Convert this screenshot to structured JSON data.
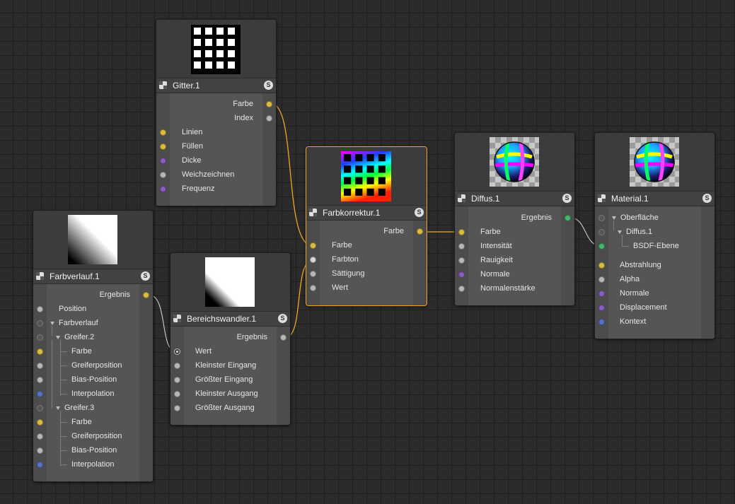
{
  "nodes": {
    "gitter": {
      "title": "Gitter.1",
      "outputs": [
        {
          "label": "Farbe"
        },
        {
          "label": "Index"
        }
      ],
      "inputs": [
        {
          "label": "Linien"
        },
        {
          "label": "Füllen"
        },
        {
          "label": "Dicke"
        },
        {
          "label": "Weichzeichnen"
        },
        {
          "label": "Frequenz"
        }
      ]
    },
    "farbverlauf": {
      "title": "Farbverlauf.1",
      "output": "Ergebnis",
      "rows": [
        {
          "label": "Position"
        },
        {
          "label": "Farbverlauf"
        },
        {
          "label": "Greifer.2"
        },
        {
          "label": "Farbe"
        },
        {
          "label": "Greiferposition"
        },
        {
          "label": "Bias-Position"
        },
        {
          "label": "Interpolation"
        },
        {
          "label": "Greifer.3"
        },
        {
          "label": "Farbe"
        },
        {
          "label": "Greiferposition"
        },
        {
          "label": "Bias-Position"
        },
        {
          "label": "Interpolation"
        }
      ]
    },
    "bereichswandler": {
      "title": "Bereichswandler.1",
      "output": "Ergebnis",
      "inputs": [
        {
          "label": "Wert"
        },
        {
          "label": "Kleinster Eingang"
        },
        {
          "label": "Größter Eingang"
        },
        {
          "label": "Kleinster Ausgang"
        },
        {
          "label": "Größter Ausgang"
        }
      ]
    },
    "farbkorrektur": {
      "title": "Farbkorrektur.1",
      "output": "Farbe",
      "inputs": [
        {
          "label": "Farbe"
        },
        {
          "label": "Farbton"
        },
        {
          "label": "Sättigung"
        },
        {
          "label": "Wert"
        }
      ]
    },
    "diffus": {
      "title": "Diffus.1",
      "output": "Ergebnis",
      "inputs": [
        {
          "label": "Farbe"
        },
        {
          "label": "Intensität"
        },
        {
          "label": "Rauigkeit"
        },
        {
          "label": "Normale"
        },
        {
          "label": "Normalenstärke"
        }
      ]
    },
    "material": {
      "title": "Material.1",
      "tree": [
        {
          "label": "Oberfläche"
        },
        {
          "label": "Diffus.1"
        },
        {
          "label": "BSDF-Ebene"
        }
      ],
      "inputs": [
        {
          "label": "Abstrahlung"
        },
        {
          "label": "Alpha"
        },
        {
          "label": "Normale"
        },
        {
          "label": "Displacement"
        },
        {
          "label": "Kontext"
        }
      ]
    }
  },
  "solo_label": "S",
  "colors": {
    "wire": "#f0a623",
    "wire_grey": "#cfcfcf",
    "port_color": "#d9bb3f",
    "port_vector": "#8a5cc4",
    "port_context": "#5574c9",
    "port_bsdf": "#43b66f",
    "port_value": "#b7b7b7",
    "selection": "#f5a623"
  }
}
